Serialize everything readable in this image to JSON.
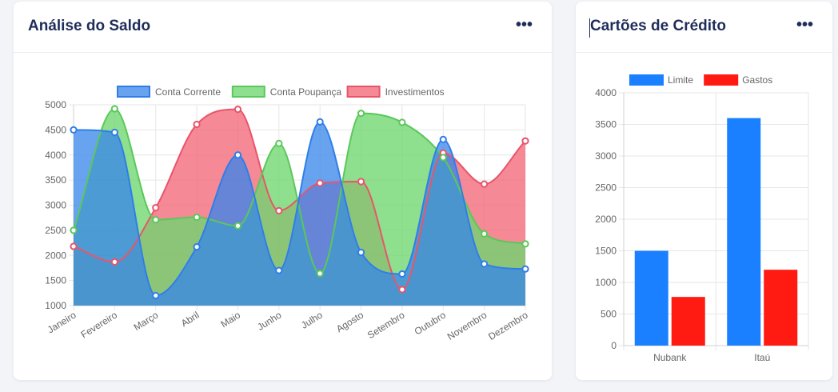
{
  "saldo_card": {
    "title": "Análise do Saldo",
    "menu": "•••"
  },
  "cartoes_card": {
    "title": "Cartões de Crédito",
    "menu": "•••"
  },
  "chart_data": [
    {
      "type": "area",
      "title": "",
      "x": [
        "Janeiro",
        "Fevereiro",
        "Março",
        "Abril",
        "Maio",
        "Junho",
        "Julho",
        "Agosto",
        "Setembro",
        "Outubro",
        "Novembro",
        "Dezembro"
      ],
      "ylim": [
        1000,
        5000
      ],
      "yticks": [
        1000,
        1500,
        2000,
        2500,
        3000,
        3500,
        4000,
        4500,
        5000
      ],
      "grid": true,
      "legend": "top",
      "series": [
        {
          "name": "Conta Corrente",
          "values": [
            4500,
            4450,
            1200,
            2170,
            4000,
            1700,
            4660,
            2060,
            1630,
            4310,
            1830,
            1730
          ],
          "color": "#2f7ee8",
          "fill": "rgba(54,132,235,0.75)"
        },
        {
          "name": "Conta Poupança",
          "values": [
            2500,
            4920,
            2710,
            2760,
            2590,
            4230,
            1640,
            4830,
            4650,
            3950,
            2430,
            2230
          ],
          "color": "#5ac85a",
          "fill": "rgba(110,214,110,0.78)"
        },
        {
          "name": "Investimentos",
          "values": [
            2180,
            1870,
            2950,
            4610,
            4910,
            2890,
            3440,
            3470,
            1320,
            4040,
            3420,
            4280
          ],
          "color": "#e8556a",
          "fill": "rgba(242,104,120,0.78)"
        }
      ]
    },
    {
      "type": "bar",
      "title": "",
      "categories": [
        "Nubank",
        "Itaú"
      ],
      "ylim": [
        0,
        4000
      ],
      "yticks": [
        0,
        500,
        1000,
        1500,
        2000,
        2500,
        3000,
        3500,
        4000
      ],
      "grid": true,
      "legend": "top",
      "series": [
        {
          "name": "Limite",
          "values": [
            1500,
            3600
          ],
          "color": "#1a80ff"
        },
        {
          "name": "Gastos",
          "values": [
            770,
            1200
          ],
          "color": "#ff1a12"
        }
      ]
    }
  ]
}
